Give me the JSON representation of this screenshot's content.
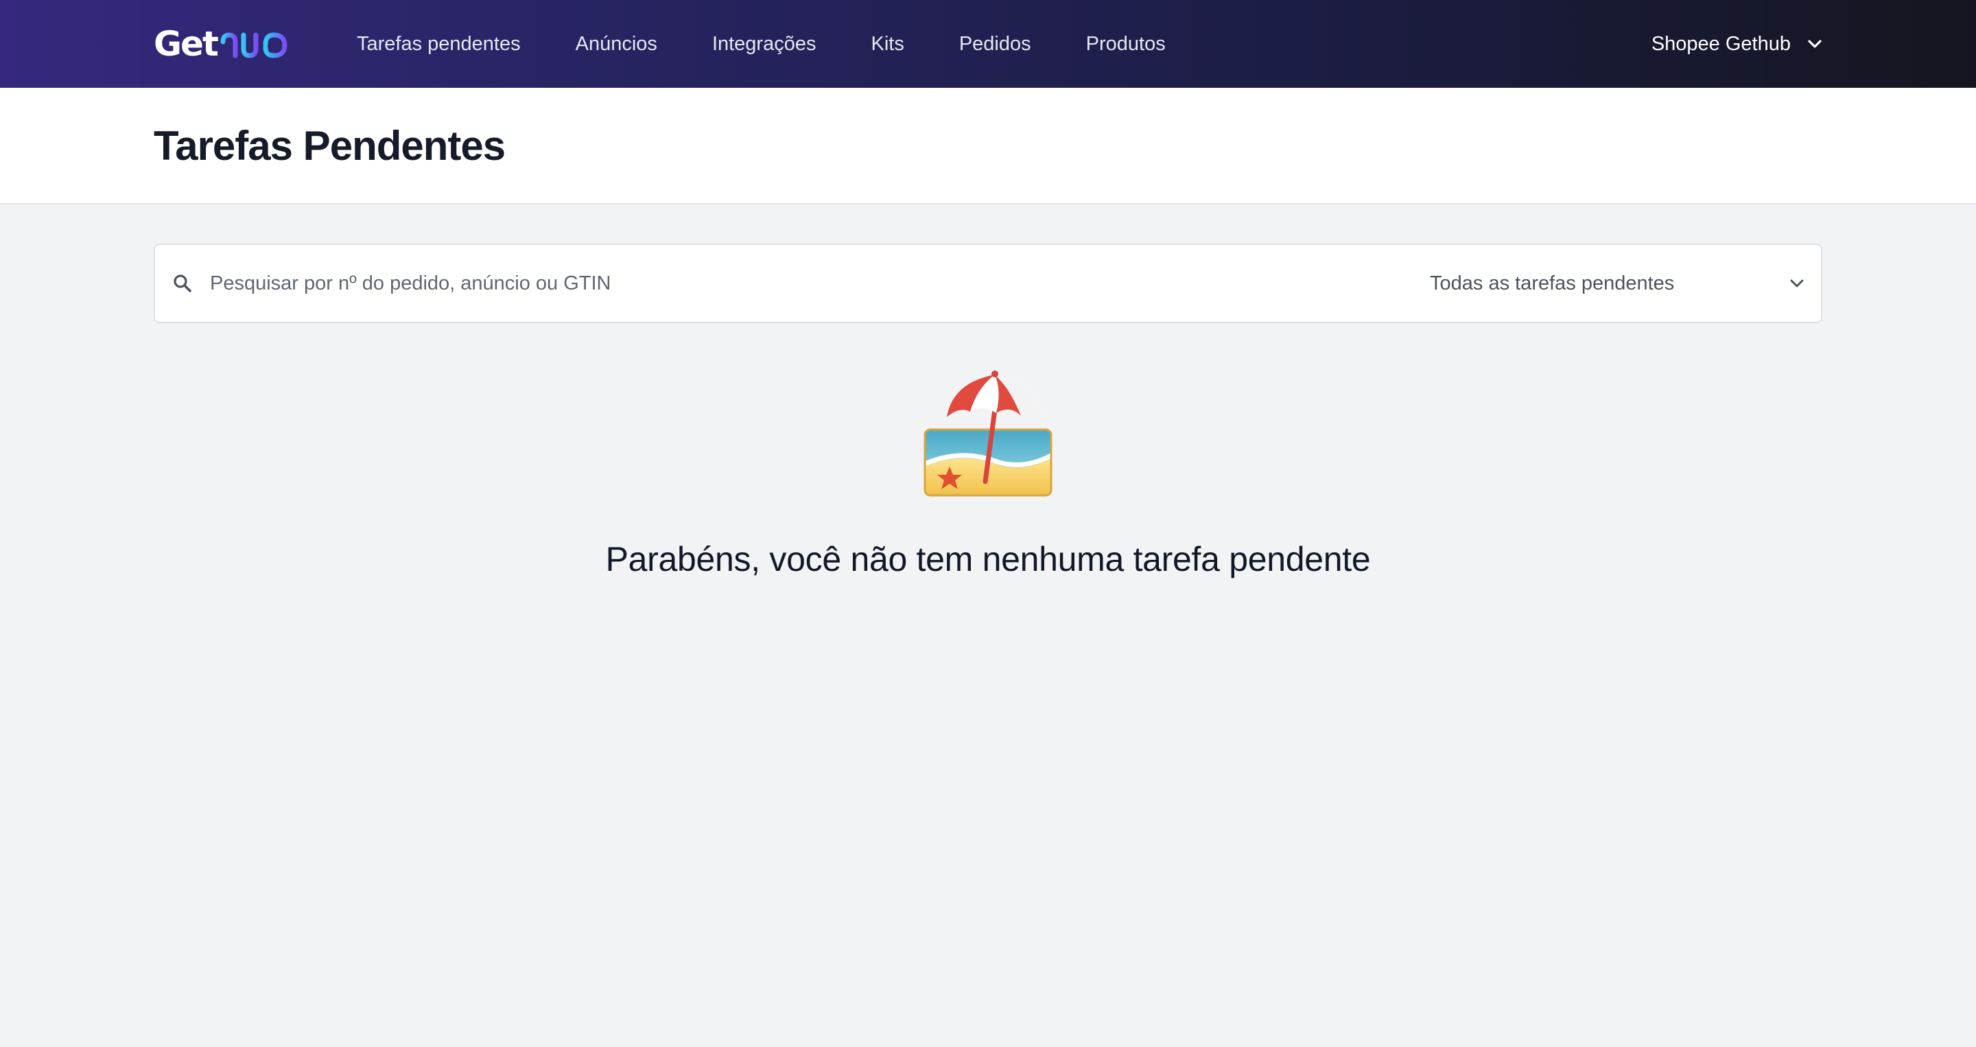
{
  "app": {
    "logo_text_primary": "Get",
    "logo_text_secondary": "hub"
  },
  "nav": {
    "items": [
      {
        "label": "Tarefas pendentes"
      },
      {
        "label": "Anúncios"
      },
      {
        "label": "Integrações"
      },
      {
        "label": "Kits"
      },
      {
        "label": "Pedidos"
      },
      {
        "label": "Produtos"
      }
    ],
    "account": {
      "label": "Shopee Gethub",
      "icon": "chevron-down-icon"
    }
  },
  "page": {
    "title": "Tarefas Pendentes"
  },
  "search": {
    "icon": "search-icon",
    "placeholder": "Pesquisar por nº do pedido, anúncio ou GTIN",
    "value": ""
  },
  "filter": {
    "selected": "Todas as tarefas pendentes",
    "icon": "chevron-down-icon"
  },
  "empty_state": {
    "icon": "beach-with-umbrella-icon",
    "message": "Parabéns, você não tem nenhuma tarefa pendente"
  },
  "colors": {
    "nav_gradient_start": "#35287e",
    "nav_gradient_end": "#14161f",
    "logo_accent": "#4f8ff7",
    "page_background": "#f2f3f5"
  }
}
